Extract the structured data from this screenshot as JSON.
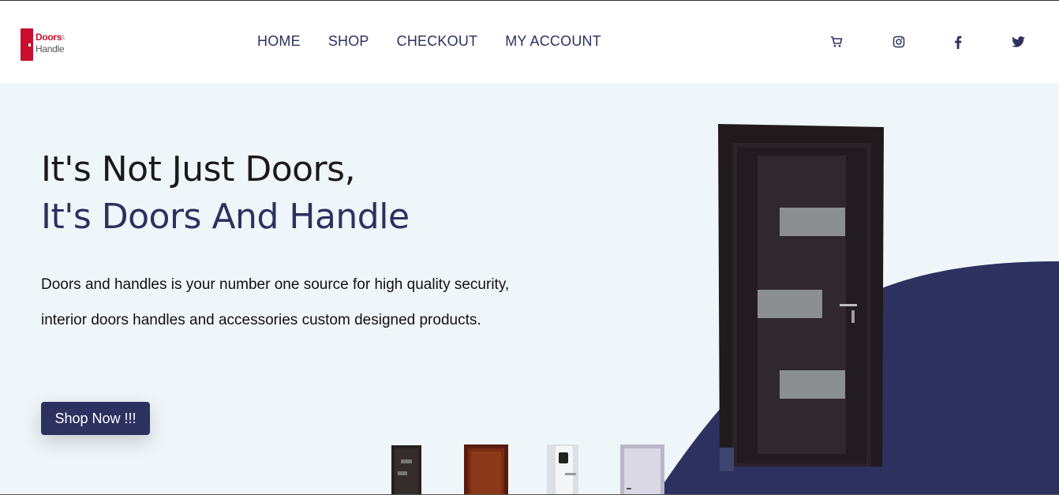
{
  "brand": {
    "logo_line1": "Doors",
    "logo_amp": "&",
    "logo_line2": "Handle",
    "colors": {
      "primary": "#2c3160",
      "logo_red": "#c8102e",
      "hero_bg": "#eff6f9"
    }
  },
  "nav": {
    "items": [
      {
        "label": "HOME"
      },
      {
        "label": "SHOP"
      },
      {
        "label": "CHECKOUT"
      },
      {
        "label": "MY ACCOUNT"
      }
    ]
  },
  "header_icons": [
    "cart-icon",
    "instagram-icon",
    "facebook-icon",
    "twitter-icon"
  ],
  "hero": {
    "title_line1": "It's Not Just Doors,",
    "title_line2": "It's Doors And Handle",
    "description": "Doors and handles is your number one source for high quality security, interior doors  handles and accessories custom designed products.",
    "cta_label": "Shop Now !!!"
  }
}
